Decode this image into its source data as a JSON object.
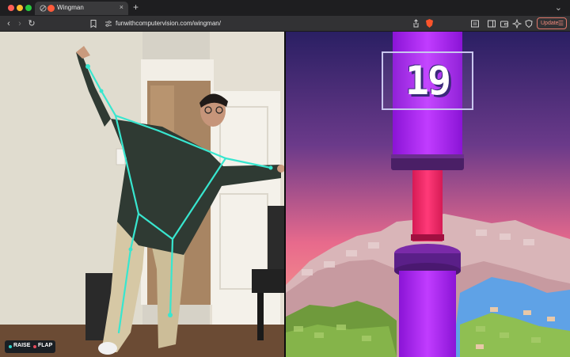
{
  "browser": {
    "tab_title": "Wingman",
    "tab_close": "×",
    "new_tab": "+",
    "url": "funwithcomputervision.com/wingman/",
    "update_label": "Update"
  },
  "webcam": {
    "legend": {
      "raise_label": "RAISE",
      "flap_label": "FLAP",
      "raise_color": "#2fd3c9",
      "flap_color": "#e34b5c"
    },
    "skeleton_color": "#38e6cf"
  },
  "game": {
    "score": "19",
    "pipe_color": "#b020e8",
    "pipe_inner_color": "#ff2d6e",
    "sky_top": "#2a1f63",
    "sky_bottom": "#ff7a8f"
  },
  "colors": {
    "accent_update": "#f08a7c"
  }
}
